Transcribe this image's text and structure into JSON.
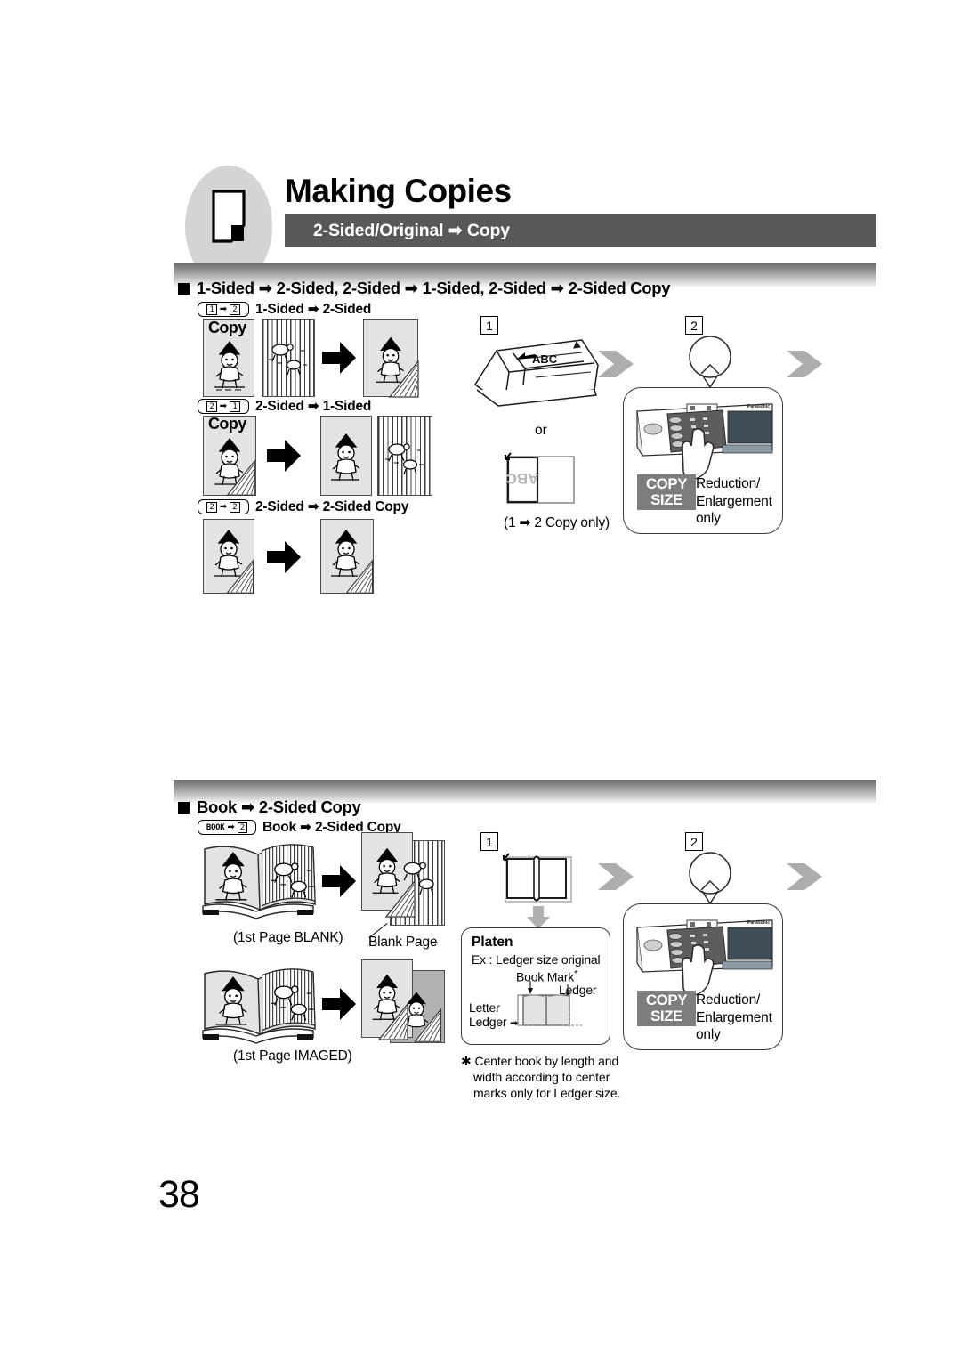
{
  "page": {
    "number": "38"
  },
  "header": {
    "title": "Making Copies",
    "subtitle": "2-Sided/Original ➡ Copy",
    "icon": "document-page-icon"
  },
  "sections": [
    {
      "id": "two-sided",
      "heading": "1-Sided ➡ 2-Sided, 2-Sided ➡ 1-Sided, 2-Sided ➡ 2-Sided Copy",
      "modes": [
        {
          "chip_left": "1",
          "chip_arrow": "➡",
          "chip_right": "2",
          "label": "1-Sided ➡ 2-Sided"
        },
        {
          "chip_left": "2",
          "chip_arrow": "➡",
          "chip_right": "1",
          "label": "2-Sided ➡ 1-Sided"
        },
        {
          "chip_left": "2",
          "chip_arrow": "➡",
          "chip_right": "2",
          "label": "2-Sided ➡ 2-Sided Copy"
        }
      ],
      "sheet_label": "Copy",
      "steps": {
        "step1_num": "1",
        "step2_num": "2",
        "adf_text": "ABC",
        "or_text": "or",
        "platen_text": "ABC",
        "platen_caption": "(1 ➡ 2 Copy only)",
        "copy_size_line1": "COPY",
        "copy_size_line2": "SIZE",
        "note_line1": "Reduction/",
        "note_line2": "Enlargement",
        "note_line3": "only",
        "brand": "Panasonic"
      }
    },
    {
      "id": "book",
      "heading": "Book ➡ 2-Sided Copy",
      "modes": [
        {
          "chip_text": "BOOK",
          "chip_arrow": "➡",
          "chip_right": "2",
          "label": "Book ➡ 2-Sided Copy"
        }
      ],
      "captions": {
        "blank": "(1st Page BLANK)",
        "imaged": "(1st Page IMAGED)",
        "blank_page": "Blank Page"
      },
      "steps": {
        "step1_num": "1",
        "step2_num": "2",
        "copy_size_line1": "COPY",
        "copy_size_line2": "SIZE",
        "note_line1": "Reduction/",
        "note_line2": "Enlargement",
        "note_line3": "only",
        "brand": "Panasonic"
      },
      "platen": {
        "title": "Platen",
        "example": "Ex : Ledger size original",
        "book_mark": "Book Mark",
        "book_mark_star": "*",
        "ledger": "Ledger",
        "letter": "Letter",
        "ledger_left": "Ledger",
        "ledger_arrow": "➡",
        "footnote_star": "✱",
        "footnote_l1": "Center book by length and",
        "footnote_l2": "width according to center",
        "footnote_l3": "marks only for Ledger size."
      }
    }
  ],
  "colors": {
    "band": "#58585a",
    "chip_gray": "#7d7d7d",
    "sheet_fill": "#e3e3e3",
    "accent_gray": "#9a9a9a"
  }
}
